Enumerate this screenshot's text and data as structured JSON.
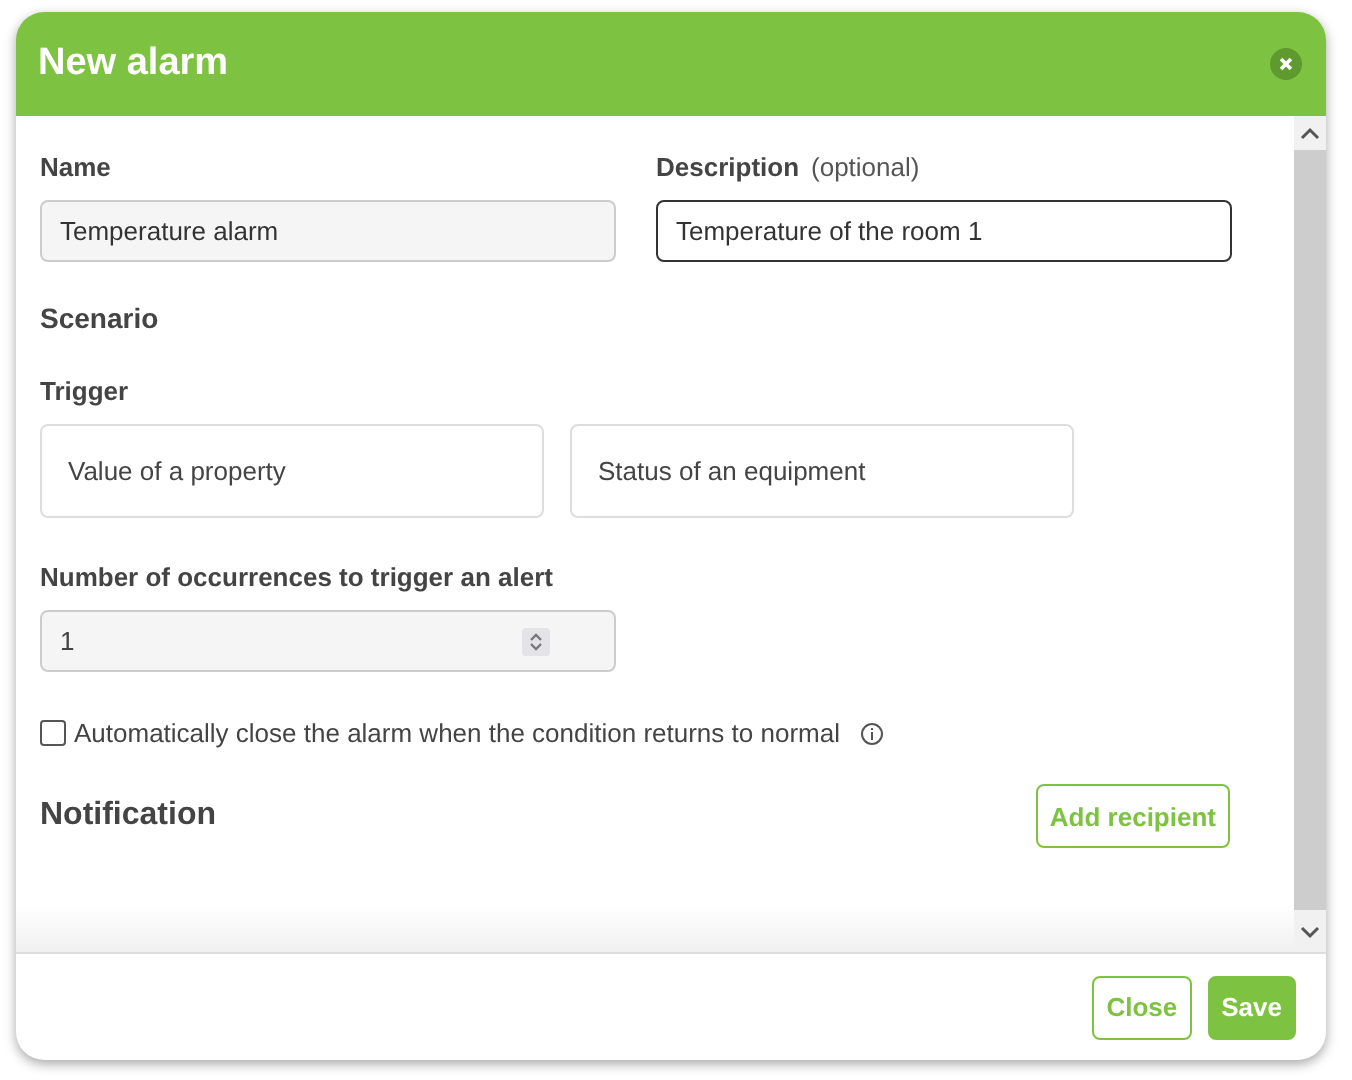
{
  "dialog": {
    "title": "New alarm"
  },
  "fields": [
    {
      "label": "Name",
      "value": "Temperature alarm",
      "focused": false
    },
    {
      "label": "Description",
      "hint": "(optional)",
      "value": "Temperature of the room 1",
      "focused": true
    }
  ],
  "scenario": {
    "title": "Scenario",
    "trigger_label": "Trigger",
    "triggers": [
      {
        "label": "Value of a property",
        "selected": false
      },
      {
        "label": "Status of an equipment",
        "selected": false
      }
    ],
    "occurrences": {
      "label": "Number of occurrences to trigger an alert",
      "value": "1"
    },
    "auto_close": {
      "label": "Automatically close the alarm when the condition returns to normal",
      "checked": false
    }
  },
  "notification": {
    "title": "Notification",
    "button": "Add recipient"
  },
  "buttons": [
    {
      "label": "Close",
      "kind": "outline"
    },
    {
      "label": "Save",
      "kind": "filled"
    }
  ]
}
